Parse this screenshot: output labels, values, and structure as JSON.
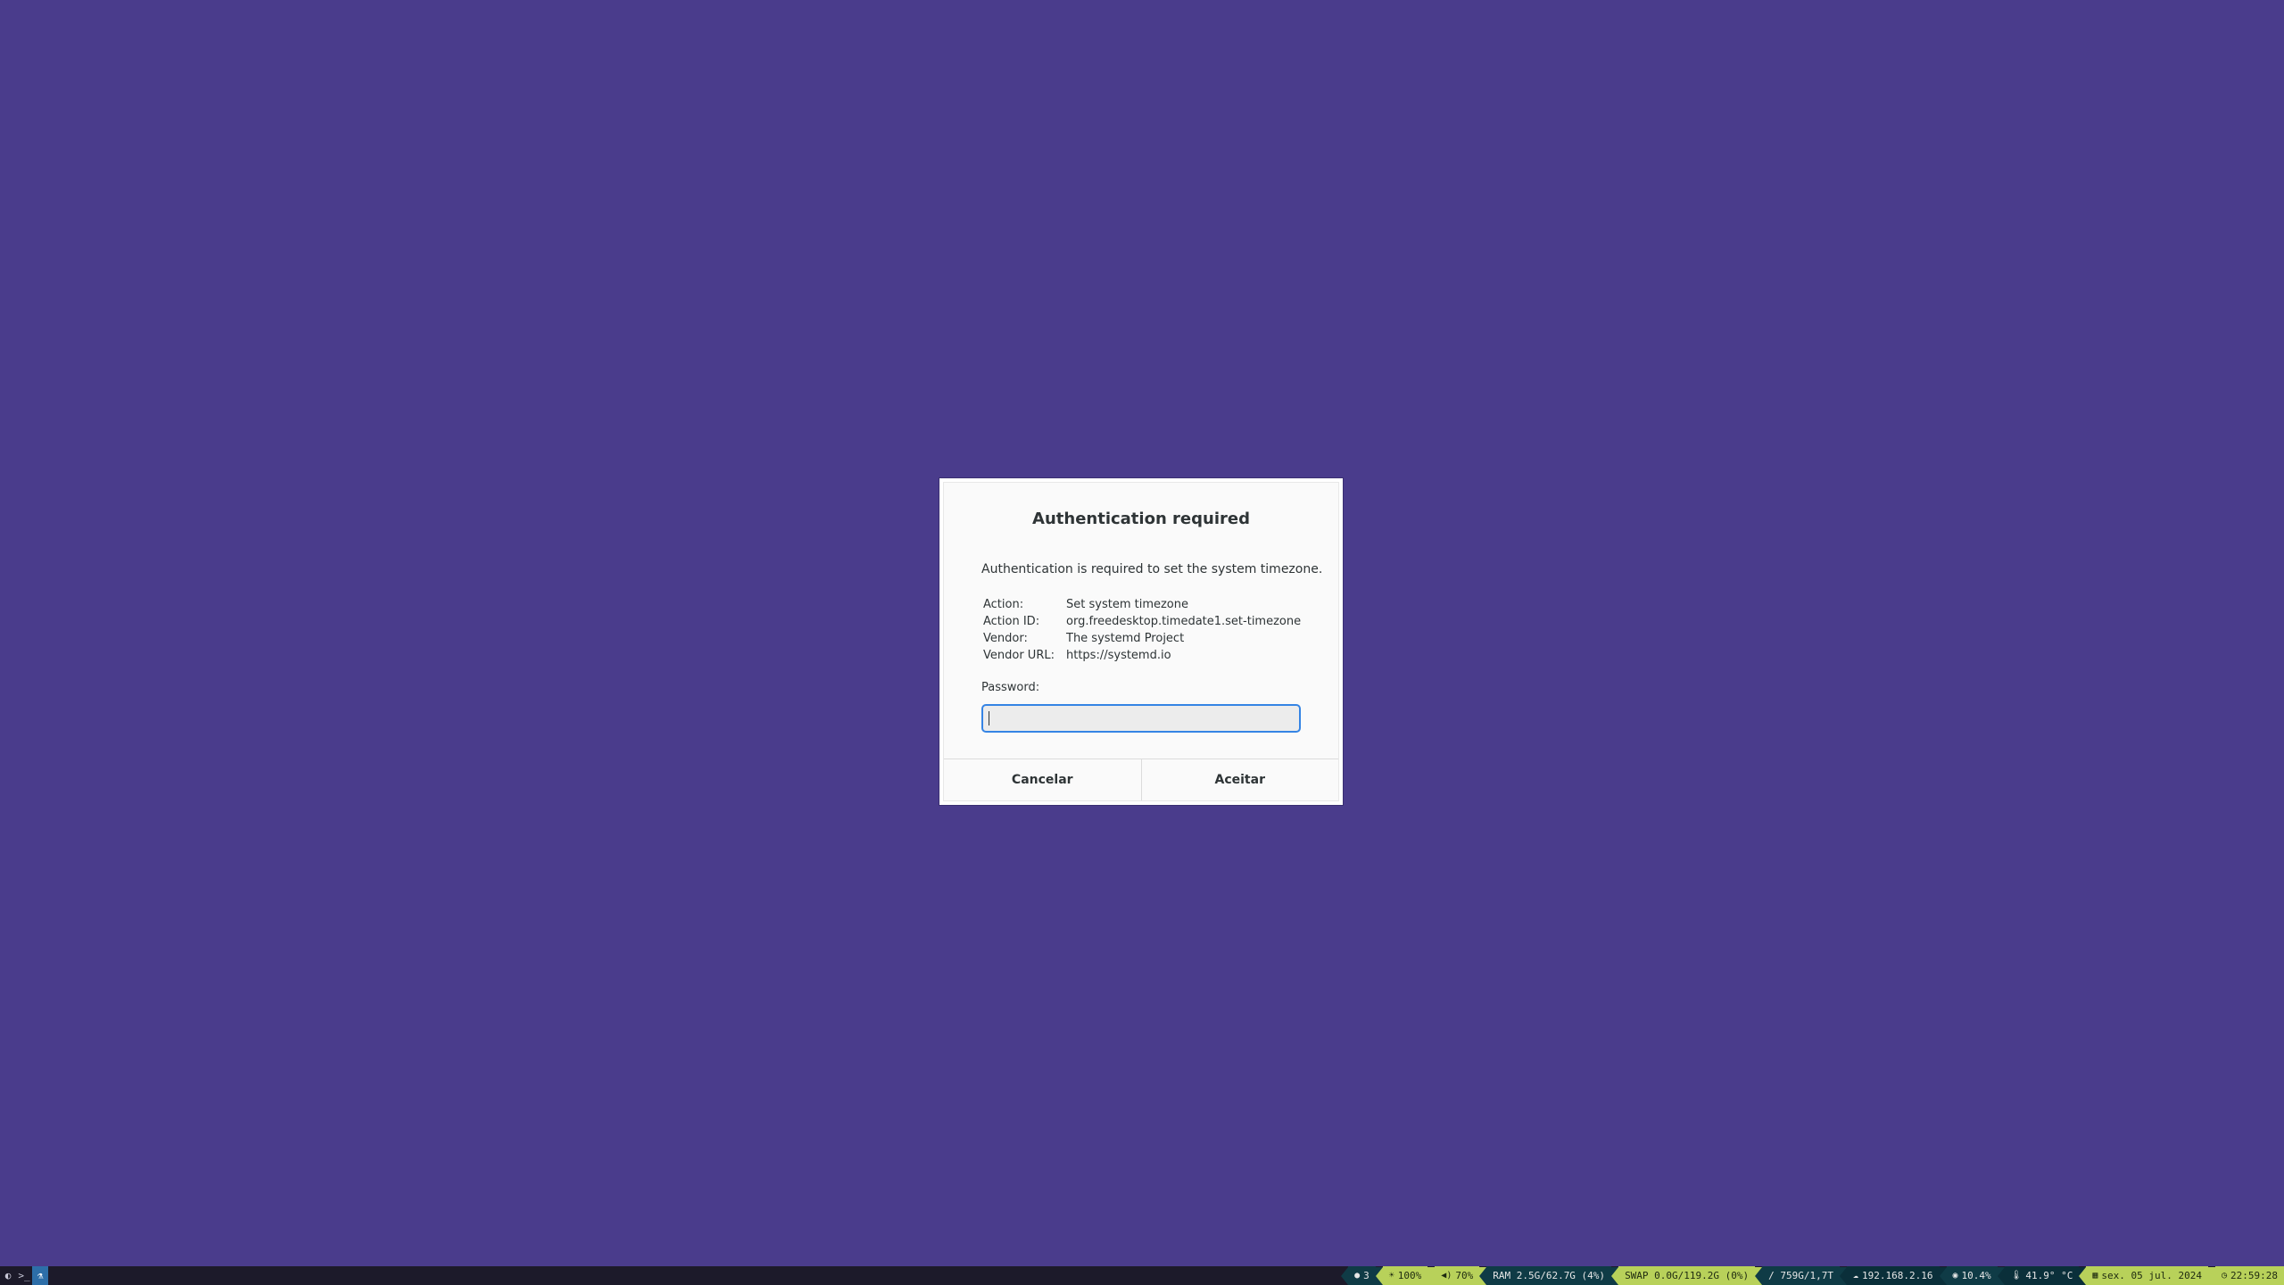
{
  "dialog": {
    "title": "Authentication required",
    "message": "Authentication is required to set the system timezone.",
    "details": [
      {
        "key": "Action:",
        "value": "Set system timezone"
      },
      {
        "key": "Action ID:",
        "value": "org.freedesktop.timedate1.set-timezone"
      },
      {
        "key": "Vendor:",
        "value": "The systemd Project"
      },
      {
        "key": "Vendor URL:",
        "value": "https://systemd.io"
      }
    ],
    "password_label": "Password:",
    "password_value": "",
    "cancel_label": "Cancelar",
    "accept_label": "Aceitar"
  },
  "taskbar": {
    "left_icons": [
      "chrome-icon",
      "terminal-icon",
      "flask-icon"
    ],
    "updates": "3",
    "brightness": "100%",
    "volume": "70%",
    "ram": "RAM 2.5G/62.7G (4%)",
    "swap": "SWAP 0.0G/119.2G (0%)",
    "disk": "/ 759G/1,7T",
    "ip": "192.168.2.16",
    "cpu": "10.4%",
    "temperature": "41.9° °C",
    "date": "sex. 05 jul. 2024",
    "time": "22:59:28"
  },
  "colors": {
    "desktop": "#4a3c8c",
    "accent": "#3584e4",
    "bar_dark": "#0f3b46",
    "bar_lime": "#b8d15a"
  }
}
